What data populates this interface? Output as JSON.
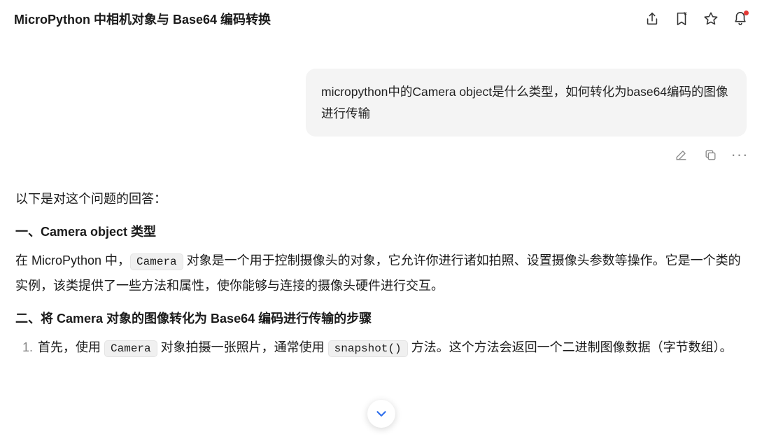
{
  "header": {
    "title": "MicroPython 中相机对象与 Base64 编码转换"
  },
  "user_message": "micropython中的Camera object是什么类型，如何转化为base64编码的图像进行传输",
  "answer": {
    "intro": "以下是对这个问题的回答：",
    "h1": "一、Camera object 类型",
    "p1_a": "在 MicroPython 中，",
    "p1_code": "Camera",
    "p1_b": " 对象是一个用于控制摄像头的对象，它允许你进行诸如拍照、设置摄像头参数等操作。它是一个类的实例，该类提供了一些方法和属性，使你能够与连接的摄像头硬件进行交互。",
    "h2": "二、将 Camera 对象的图像转化为 Base64 编码进行传输的步骤",
    "li1_a": "首先，使用 ",
    "li1_code1": "Camera",
    "li1_b": " 对象拍摄一张照片，通常使用 ",
    "li1_code2": "snapshot()",
    "li1_c": " 方法。这个方法会返回一个二进制图像数据（字节数组）。"
  }
}
